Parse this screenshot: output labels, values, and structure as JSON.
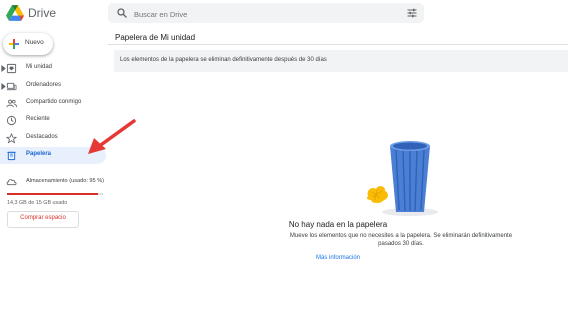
{
  "header": {
    "app_name": "Drive",
    "search_placeholder": "Buscar en Drive",
    "icons": [
      "drive-logo",
      "search-icon",
      "tune-icon"
    ]
  },
  "sidebar": {
    "new_button": "Nuevo",
    "items": [
      {
        "label": "Mi unidad",
        "icon": "my-drive-icon",
        "expandable": true
      },
      {
        "label": "Ordenadores",
        "icon": "computer-icon",
        "expandable": true
      },
      {
        "label": "Compartido conmigo",
        "icon": "shared-icon",
        "expandable": false
      },
      {
        "label": "Reciente",
        "icon": "clock-icon",
        "expandable": false
      },
      {
        "label": "Destacados",
        "icon": "star-icon",
        "expandable": false
      },
      {
        "label": "Papelera",
        "icon": "trash-icon",
        "expandable": false,
        "active": true
      }
    ],
    "storage": {
      "label": "Almacenamiento (usado: 95 %)",
      "used_text": "14,3 GB de 15 GB usado",
      "used_fraction": 0.95,
      "buy_label": "Comprar espacio"
    }
  },
  "main": {
    "title": "Papelera de Mi unidad",
    "banner": "Los elementos de la papelera se eliminan definitivamente después de 30 días",
    "empty": {
      "title": "No hay nada en la papelera",
      "description": "Mueve los elementos que no necesites a la papelera. Se eliminarán definitivamente pasados 30 días.",
      "link": "Más información"
    }
  },
  "colors": {
    "accent": "#1a73e8",
    "active_bg": "#e8f0fe",
    "active_text": "#1967d2",
    "storage_bar": "#d93025",
    "annotation_arrow": "#e53935"
  }
}
